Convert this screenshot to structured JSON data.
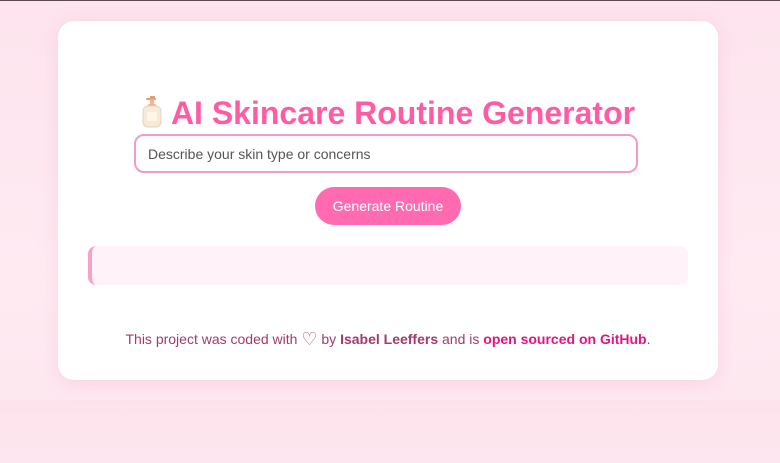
{
  "header": {
    "title": "AI Skincare Routine Generator",
    "icon": "lotion-bottle-icon"
  },
  "form": {
    "input_placeholder": "Describe your skin type or concerns",
    "input_value": "",
    "button_label": "Generate Routine"
  },
  "result": {
    "text": ""
  },
  "footer": {
    "prefix": "This project was coded with",
    "heart": "♡",
    "by": "by",
    "author": "Isabel Leeffers",
    "middle": "and is",
    "link_text": "open sourced on GitHub",
    "suffix": "."
  },
  "colors": {
    "accent": "#ff5ca3",
    "button": "#ff6ab1",
    "input_border": "#f59ac3",
    "footer_text": "#a13a70",
    "link": "#e0157f",
    "background": "#fde4ee"
  }
}
